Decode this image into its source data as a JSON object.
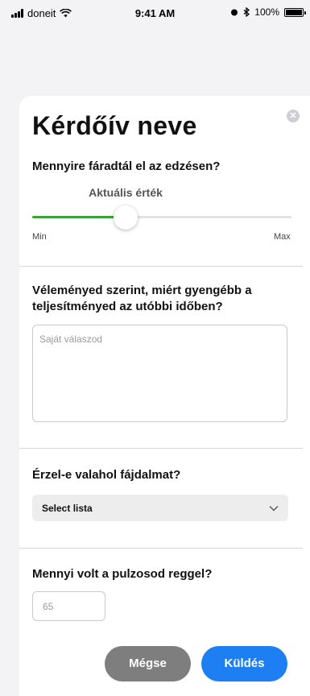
{
  "status_bar": {
    "carrier": "doneit",
    "time": "9:41 AM",
    "battery": "100%",
    "icons": [
      "signal-icon",
      "wifi-icon",
      "alarm-icon",
      "bluetooth-icon",
      "battery-icon"
    ]
  },
  "survey": {
    "title": "Kérdőív neve",
    "close_icon": "close-icon",
    "question1": "Mennyire fáradtál el az edzésen?",
    "slider": {
      "current_label": "Aktuális érték",
      "min_label": "Min",
      "max_label": "Max",
      "value_fraction": 0.36,
      "accent": "#3aa43a"
    },
    "question2": "Véleményed szerint, miért gyengébb a teljesítményed az utóbbi időben?",
    "answer_placeholder": "Saját válaszod",
    "question3": "Érzel-e valahol fájdalmat?",
    "select_value": "Select lista",
    "question4": "Mennyi volt a pulzosod reggel?",
    "pulse_placeholder": "65",
    "cancel_label": "Mégse",
    "send_label": "Küldés",
    "colors": {
      "send": "#1e7ff2",
      "cancel": "#7e7e7e"
    }
  }
}
